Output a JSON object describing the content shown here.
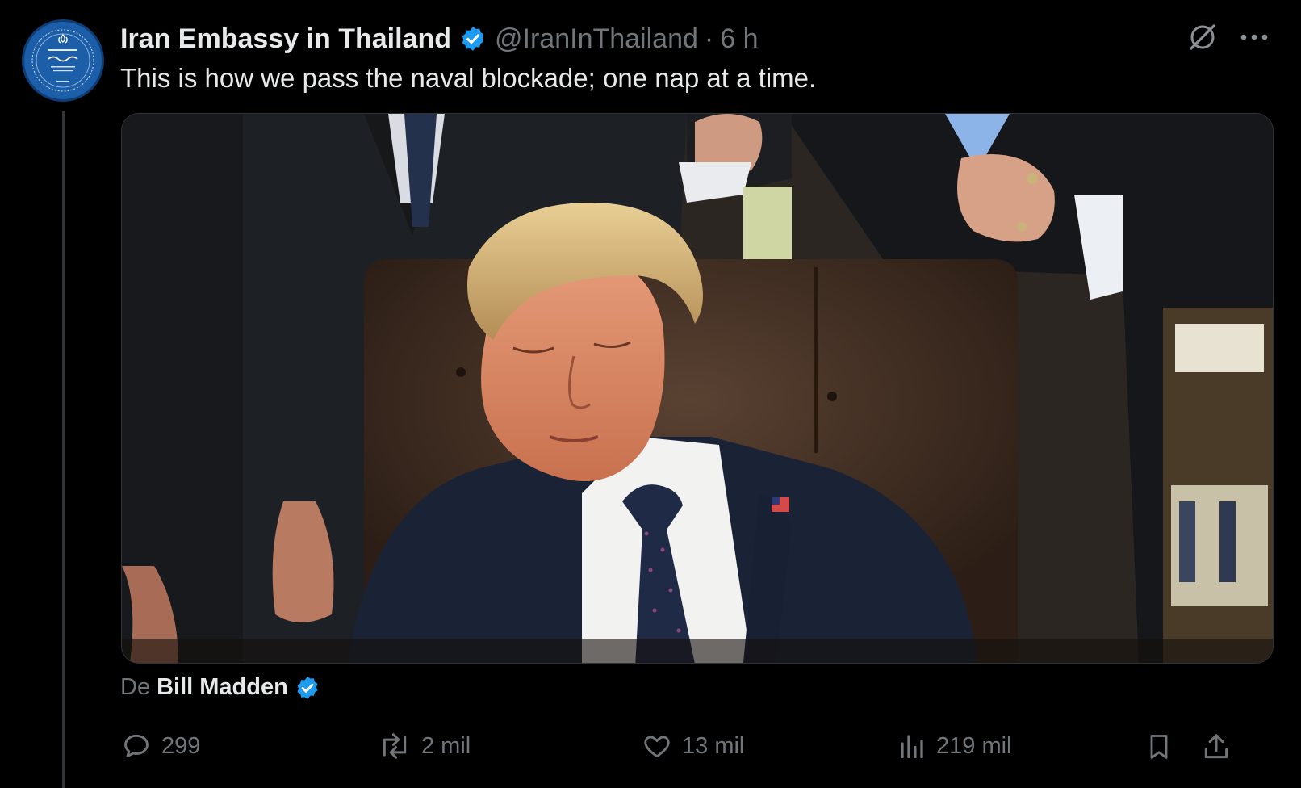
{
  "tweet": {
    "author": {
      "display_name": "Iran Embassy in Thailand",
      "handle": "@IranInThailand",
      "separator": "·",
      "time_ago": "6 h",
      "verified": true
    },
    "text": "This is how we pass the naval blockade; one nap at a time.",
    "media": {
      "type": "video-still"
    },
    "attribution": {
      "prefix": "De",
      "name": "Bill Madden",
      "verified": true
    },
    "stats": {
      "replies": "299",
      "reposts": "2 mil",
      "likes": "13 mil",
      "views": "219 mil"
    }
  },
  "icons": {
    "verified": "verified-badge-icon",
    "grok": "grok-icon",
    "more": "more-icon",
    "reply": "reply-icon",
    "repost": "repost-icon",
    "like": "heart-icon",
    "views": "views-icon",
    "bookmark": "bookmark-icon",
    "share": "share-icon"
  },
  "colors": {
    "background": "#000000",
    "text_primary": "#e7e9ea",
    "text_secondary": "#71767b",
    "verified_blue": "#1d9bf0",
    "avatar_blue": "#1c5ea8"
  }
}
